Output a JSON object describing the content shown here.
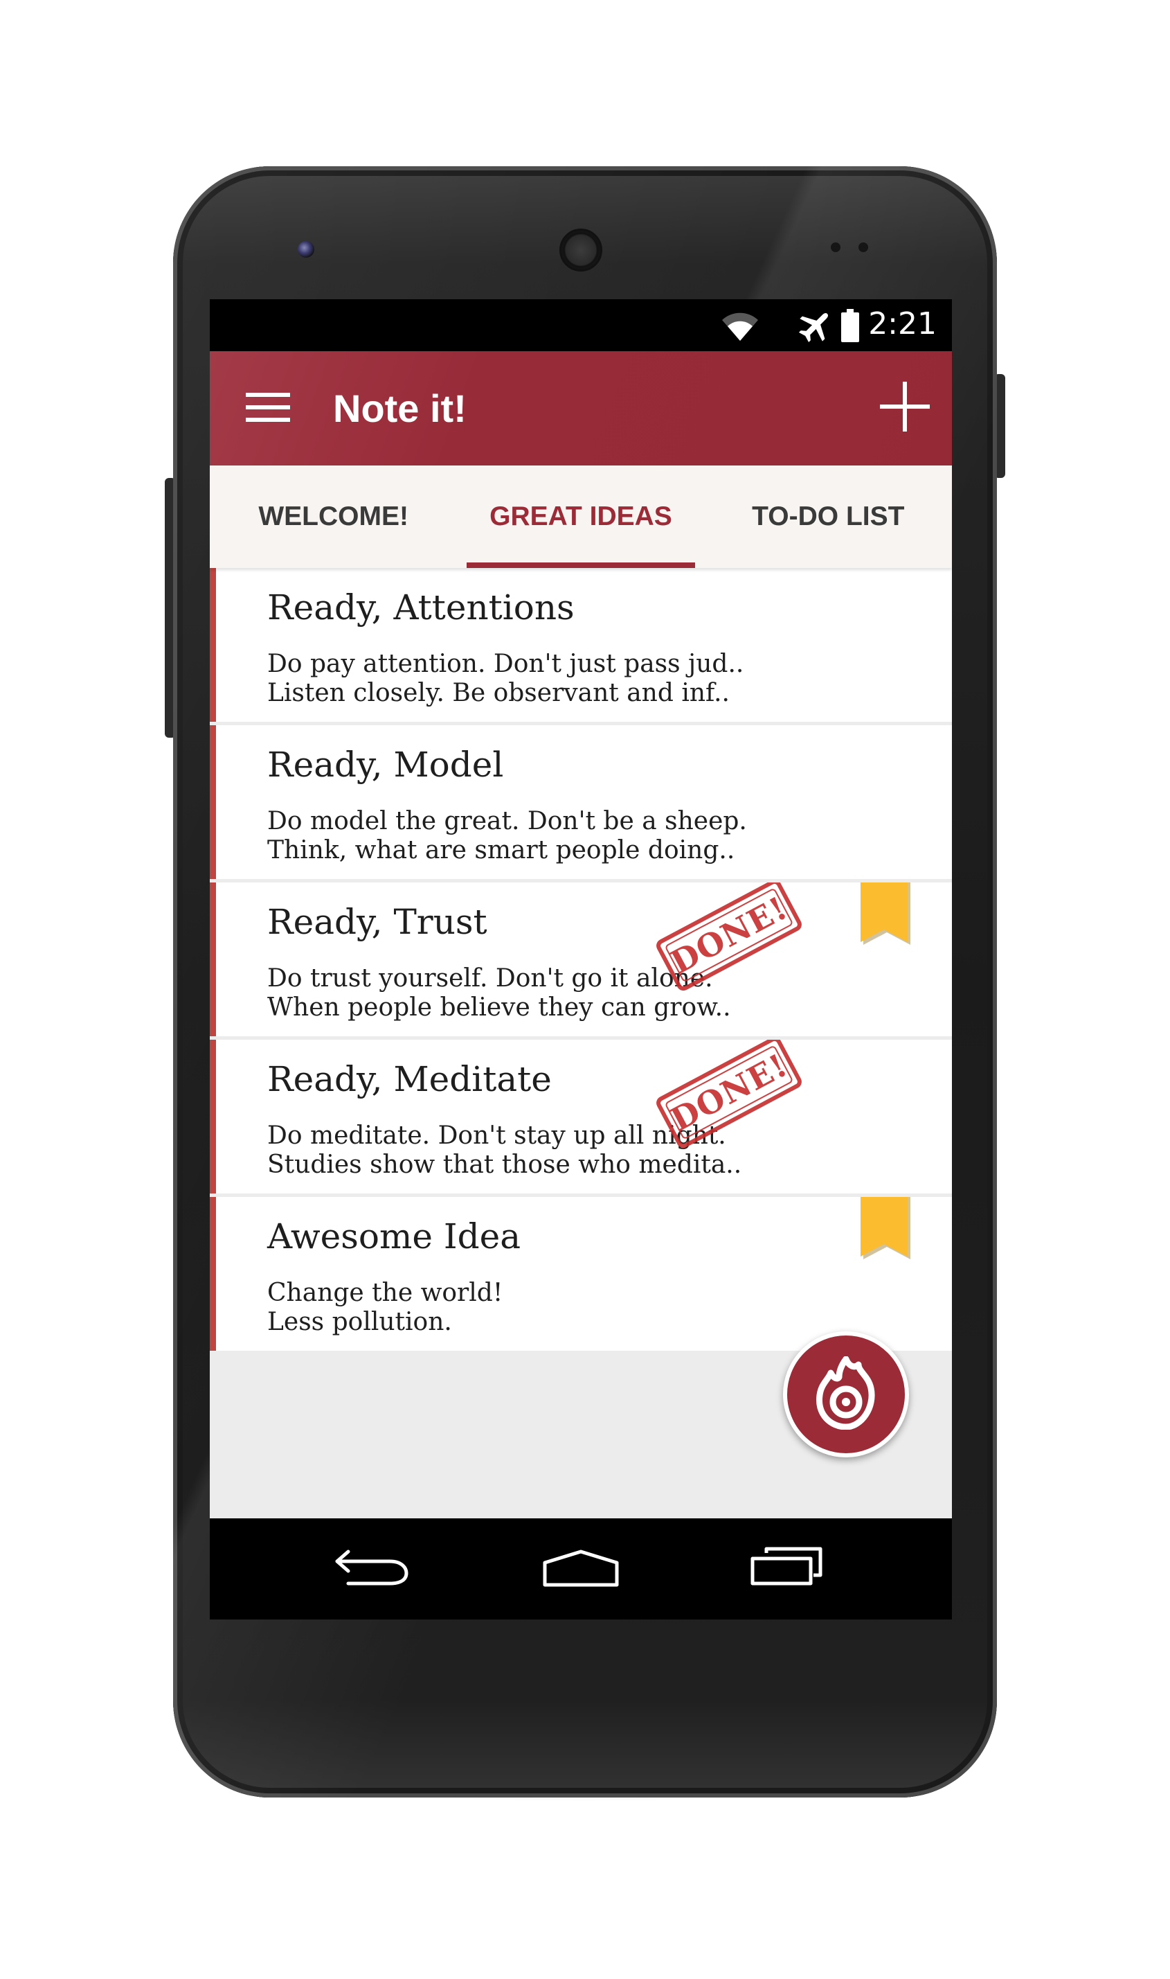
{
  "status_bar": {
    "time": "2:21",
    "icons": [
      "wifi-icon",
      "airplane-mode-icon",
      "battery-icon"
    ]
  },
  "app_bar": {
    "title": "Note it!",
    "menu_icon": "hamburger-menu-icon",
    "add_icon": "plus-icon",
    "color": "#982b38"
  },
  "tabs": [
    {
      "label": "WELCOME!",
      "active": false
    },
    {
      "label": "GREAT IDEAS",
      "active": true
    },
    {
      "label": "TO-DO LIST",
      "active": false
    }
  ],
  "notes": [
    {
      "title": "Ready, Attentions",
      "line1": "Do pay attention. Don't just pass jud..",
      "line2": "Listen closely. Be observant and inf..",
      "bookmarked": false,
      "done": false
    },
    {
      "title": "Ready, Model",
      "line1": "Do model the great. Don't be a sheep.",
      "line2": "Think, what are smart people doing..",
      "bookmarked": false,
      "done": false
    },
    {
      "title": "Ready, Trust",
      "line1": "Do trust yourself. Don't go it alone.",
      "line2": "When people believe they can grow..",
      "bookmarked": true,
      "done": true,
      "stamp": "DONE!"
    },
    {
      "title": "Ready, Meditate",
      "line1": "Do meditate. Don't stay up all night.",
      "line2": "Studies show that those who medita..",
      "bookmarked": false,
      "done": true,
      "stamp": "DONE!"
    },
    {
      "title": "Awesome Idea",
      "line1": "Change the world!",
      "line2": "Less pollution.",
      "bookmarked": true,
      "done": false
    }
  ],
  "fab": {
    "icon": "flame-icon",
    "color": "#9a2b37"
  },
  "nav_bar": {
    "icons": [
      "back-icon",
      "home-icon",
      "recent-apps-icon"
    ]
  },
  "colors": {
    "accent": "#9a2b37",
    "note_border": "#c0443f",
    "bookmark": "#fbbc2f",
    "stamp": "#c62c2c"
  }
}
